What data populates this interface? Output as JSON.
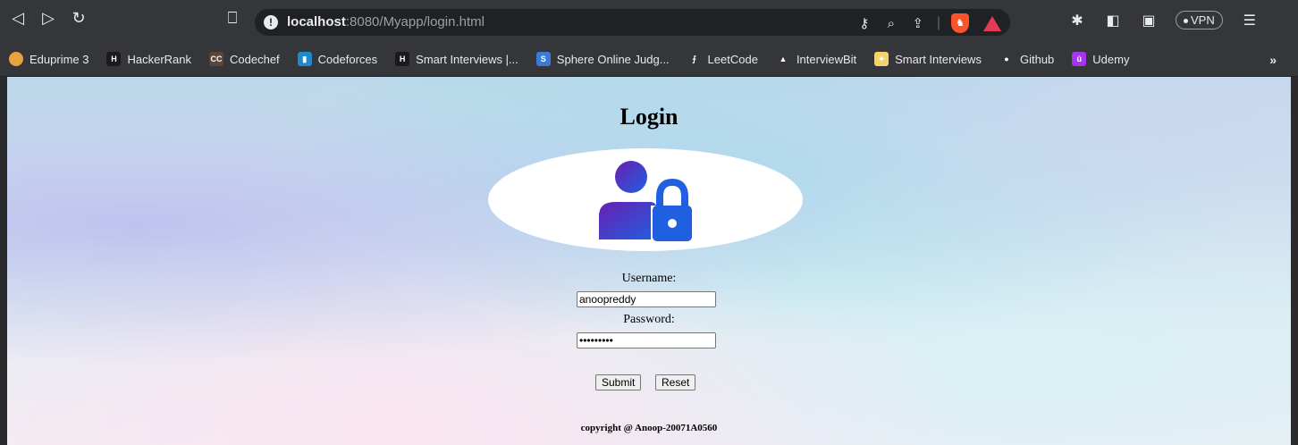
{
  "browser": {
    "url_host": "localhost",
    "url_rest": ":8080/Myapp/login.html",
    "vpn_label": "VPN",
    "more_label": "»",
    "bookmarks": [
      {
        "label": "Eduprime 3",
        "icon_text": "",
        "color": "#e8a33d"
      },
      {
        "label": "HackerRank",
        "icon_text": "H",
        "color": "#1a1a1a"
      },
      {
        "label": "Codechef",
        "icon_text": "CC",
        "color": "#5b4638"
      },
      {
        "label": "Codeforces",
        "icon_text": "▮",
        "color": "#1f8acb"
      },
      {
        "label": "Smart Interviews |...",
        "icon_text": "H",
        "color": "#1a1a1a"
      },
      {
        "label": "Sphere Online Judg...",
        "icon_text": "S",
        "color": "#3a7bd5"
      },
      {
        "label": "LeetCode",
        "icon_text": "⨍",
        "color": "#35363a"
      },
      {
        "label": "InterviewBit",
        "icon_text": "▲",
        "color": "#35363a"
      },
      {
        "label": "Smart Interviews",
        "icon_text": "✦",
        "color": "#f3d36b"
      },
      {
        "label": "Github",
        "icon_text": "●",
        "color": "#35363a"
      },
      {
        "label": "Udemy",
        "icon_text": "û",
        "color": "#a435f0"
      }
    ]
  },
  "page": {
    "title": "Login",
    "username_label": "Username:",
    "username_value": "anoopreddy",
    "password_label": "Password:",
    "password_value": "passwords",
    "submit_label": "Submit",
    "reset_label": "Reset",
    "footer": "copyright @ Anoop-20071A0560"
  },
  "colors": {
    "logo_gradient_start": "#6a1fb0",
    "logo_gradient_end": "#1f5fe0"
  }
}
